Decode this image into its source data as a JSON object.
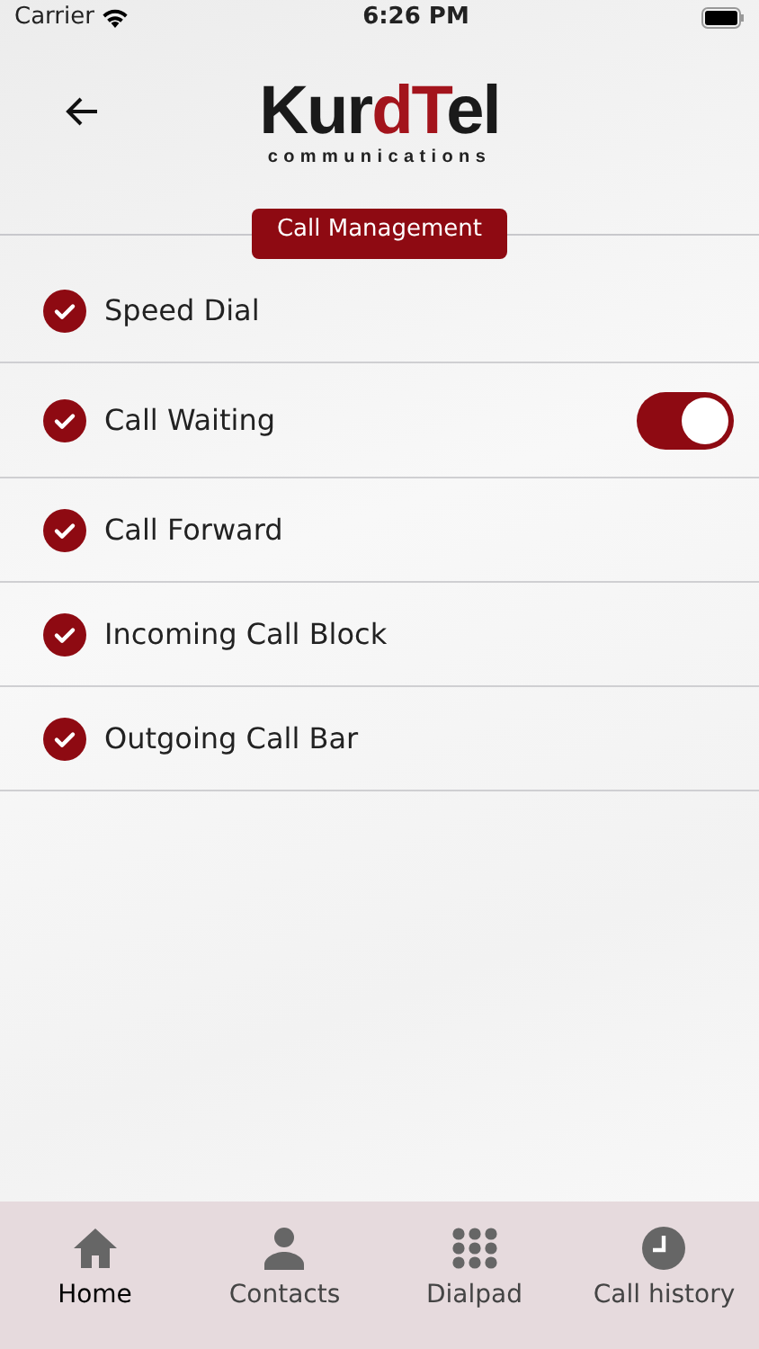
{
  "status_bar": {
    "carrier": "Carrier",
    "time": "6:26 PM"
  },
  "logo": {
    "parts": [
      {
        "text": "Kur",
        "color": "#1a1a1a"
      },
      {
        "text": "dT",
        "color": "#a3141c"
      },
      {
        "text": "el",
        "color": "#1a1a1a"
      }
    ],
    "subtitle": "communications"
  },
  "section_title": "Call Management",
  "items": [
    {
      "label": "Speed Dial",
      "checked": true,
      "kind": "plain"
    },
    {
      "label": "Call Waiting",
      "checked": true,
      "kind": "toggle",
      "on": true
    },
    {
      "label": "Call Forward",
      "checked": true,
      "kind": "plain"
    },
    {
      "label": "Incoming Call Block",
      "checked": true,
      "kind": "plain"
    },
    {
      "label": "Outgoing Call Bar",
      "checked": true,
      "kind": "plain"
    }
  ],
  "tabs": [
    {
      "label": "Home",
      "kind": "home",
      "selected": true
    },
    {
      "label": "Contacts",
      "kind": "person",
      "selected": false
    },
    {
      "label": "Dialpad",
      "kind": "dialpad",
      "selected": false
    },
    {
      "label": "Call history",
      "kind": "clock",
      "selected": false
    }
  ]
}
